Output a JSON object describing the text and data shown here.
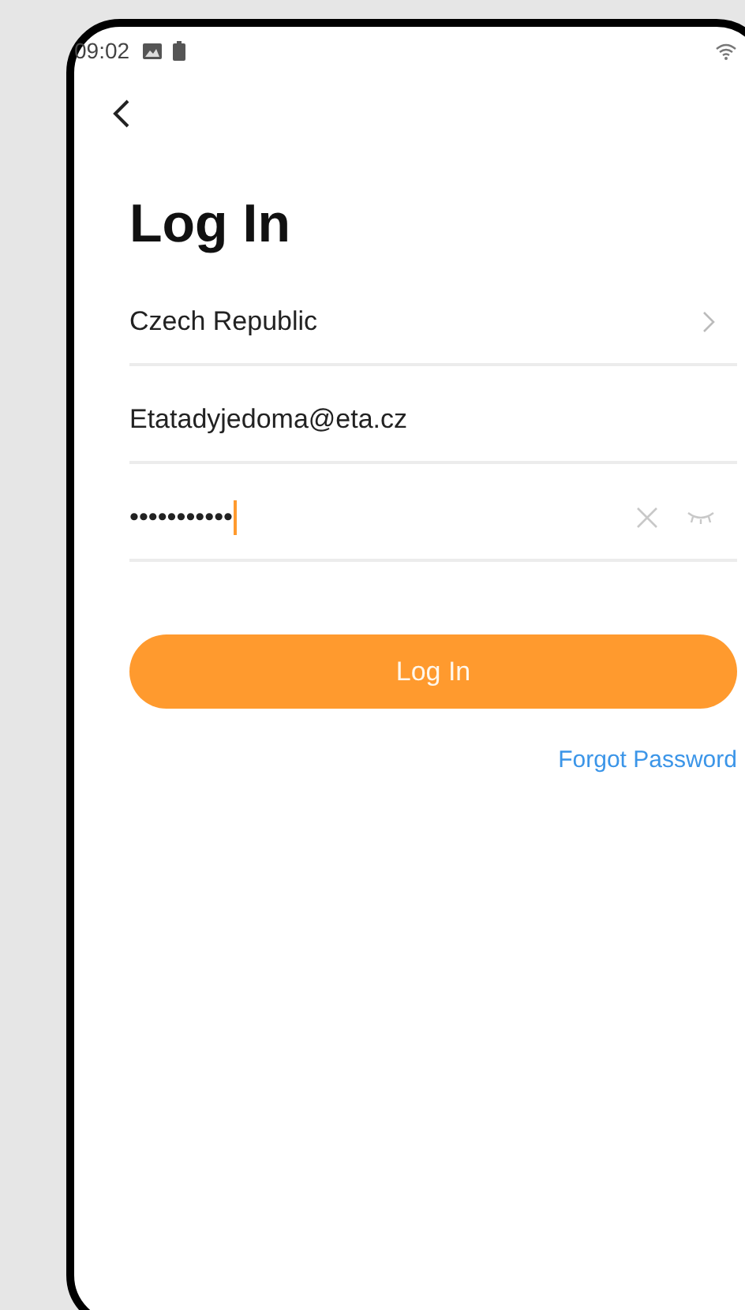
{
  "status_bar": {
    "time": "09:02"
  },
  "title": "Log In",
  "country": {
    "value": "Czech Republic"
  },
  "email": {
    "value": "Etatadyjedoma@eta.cz"
  },
  "password": {
    "value": "•••••••••••"
  },
  "login_button": "Log In",
  "forgot_password": "Forgot Password"
}
